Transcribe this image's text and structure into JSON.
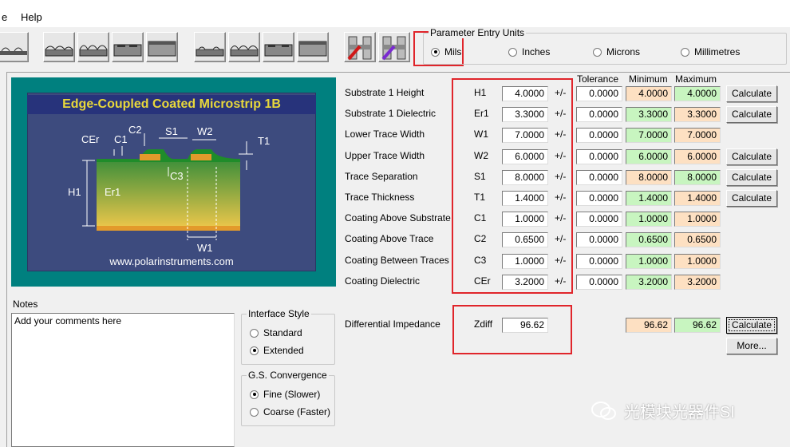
{
  "menu": {
    "items": [
      "e",
      "Help"
    ]
  },
  "toolbar": {
    "structure_buttons": 9
  },
  "units": {
    "title": "Parameter Entry Units",
    "options": [
      "Mils",
      "Inches",
      "Microns",
      "Millimetres"
    ],
    "selected": "Mils"
  },
  "diagram": {
    "title": "Edge-Coupled Coated Microstrip 1B",
    "url": "www.polarinstruments.com",
    "labels": {
      "cer": "CEr",
      "c1": "C1",
      "c2": "C2",
      "s1": "S1",
      "w2": "W2",
      "t1": "T1",
      "h1": "H1",
      "er1": "Er1",
      "c3": "C3",
      "w1": "W1"
    }
  },
  "columns": {
    "tolerance": "Tolerance",
    "minimum": "Minimum",
    "maximum": "Maximum"
  },
  "plus_minus": "+/-",
  "calculate_label": "Calculate",
  "more_label": "More...",
  "params": [
    {
      "label": "Substrate 1 Height",
      "symbol": "H1",
      "value": "4.0000",
      "tol": "0.0000",
      "min": "4.0000",
      "max": "4.0000",
      "min_color": "orange",
      "max_color": "green",
      "calc": true
    },
    {
      "label": "Substrate 1 Dielectric",
      "symbol": "Er1",
      "value": "3.3000",
      "tol": "0.0000",
      "min": "3.3000",
      "max": "3.3000",
      "min_color": "green",
      "max_color": "orange",
      "calc": true
    },
    {
      "label": "Lower Trace Width",
      "symbol": "W1",
      "value": "7.0000",
      "tol": "0.0000",
      "min": "7.0000",
      "max": "7.0000",
      "min_color": "green",
      "max_color": "orange",
      "calc": false
    },
    {
      "label": "Upper Trace Width",
      "symbol": "W2",
      "value": "6.0000",
      "tol": "0.0000",
      "min": "6.0000",
      "max": "6.0000",
      "min_color": "green",
      "max_color": "orange",
      "calc": true
    },
    {
      "label": "Trace Separation",
      "symbol": "S1",
      "value": "8.0000",
      "tol": "0.0000",
      "min": "8.0000",
      "max": "8.0000",
      "min_color": "orange",
      "max_color": "green",
      "calc": true
    },
    {
      "label": "Trace Thickness",
      "symbol": "T1",
      "value": "1.4000",
      "tol": "0.0000",
      "min": "1.4000",
      "max": "1.4000",
      "min_color": "green",
      "max_color": "orange",
      "calc": true
    },
    {
      "label": "Coating Above Substrate",
      "symbol": "C1",
      "value": "1.0000",
      "tol": "0.0000",
      "min": "1.0000",
      "max": "1.0000",
      "min_color": "green",
      "max_color": "orange",
      "calc": false
    },
    {
      "label": "Coating Above Trace",
      "symbol": "C2",
      "value": "0.6500",
      "tol": "0.0000",
      "min": "0.6500",
      "max": "0.6500",
      "min_color": "green",
      "max_color": "orange",
      "calc": false
    },
    {
      "label": "Coating Between Traces",
      "symbol": "C3",
      "value": "1.0000",
      "tol": "0.0000",
      "min": "1.0000",
      "max": "1.0000",
      "min_color": "green",
      "max_color": "orange",
      "calc": false
    },
    {
      "label": "Coating Dielectric",
      "symbol": "CEr",
      "value": "3.2000",
      "tol": "0.0000",
      "min": "3.2000",
      "max": "3.2000",
      "min_color": "green",
      "max_color": "orange",
      "calc": false
    }
  ],
  "impedance": {
    "label": "Differential Impedance",
    "symbol": "Zdiff",
    "value": "96.62",
    "min": "96.62",
    "max": "96.62"
  },
  "notes": {
    "title": "Notes",
    "text": "Add your comments here"
  },
  "interface_style": {
    "title": "Interface Style",
    "options": [
      "Standard",
      "Extended"
    ],
    "selected": "Extended"
  },
  "convergence": {
    "title": "G.S. Convergence",
    "options": [
      "Fine (Slower)",
      "Coarse (Faster)"
    ],
    "selected": "Fine (Slower)"
  },
  "watermark": "光模块光器件SI",
  "colors": {
    "orange_field": "#fde0c2",
    "green_field": "#c8f5c0",
    "highlight_red": "#e0252b",
    "diagram_frame": "#00807f",
    "diagram_title": "#e8d83b"
  }
}
